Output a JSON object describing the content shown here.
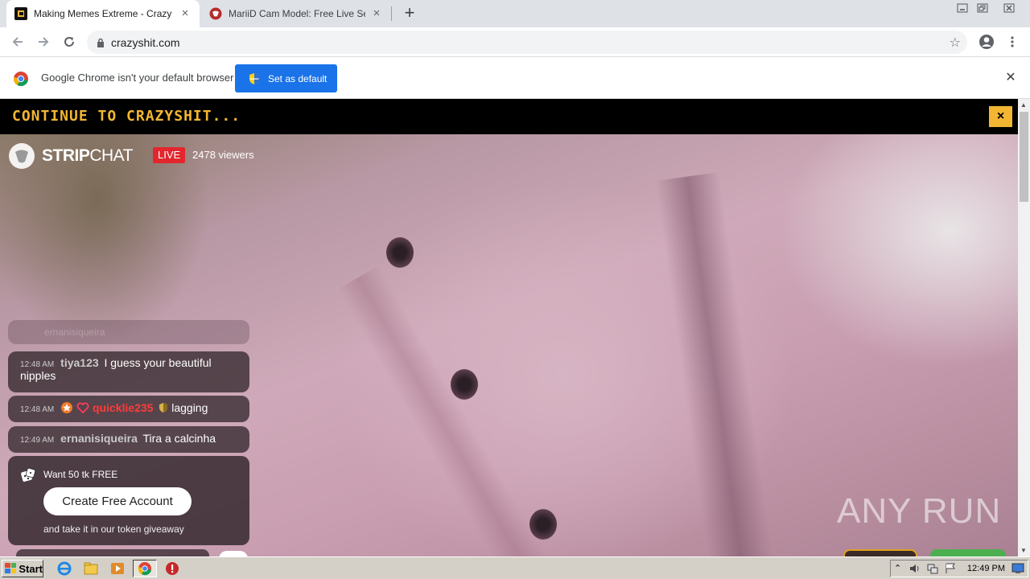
{
  "browser": {
    "tabs": [
      {
        "title": "Making Memes Extreme - Crazy Shit",
        "active": true
      },
      {
        "title": "MariiD Cam Model: Free Live Sex Sh",
        "active": false
      }
    ],
    "url": "crazyshit.com",
    "infobar": {
      "message": "Google Chrome isn't your default browser",
      "button": "Set as default"
    }
  },
  "page": {
    "banner_text": "CONTINUE TO CRAZYSHIT...",
    "banner_close": "×",
    "logo_bold": "STRIP",
    "logo_light": "CHAT",
    "live_badge": "LIVE",
    "viewers": "2478 viewers",
    "faded_message": "ernanisiqueira",
    "chat": [
      {
        "time": "12:48 AM",
        "user": "tiya123",
        "text": "I guess your beautiful nipples"
      },
      {
        "time": "12:48 AM",
        "user": "quicklie235",
        "text": "lagging"
      },
      {
        "time": "12:49 AM",
        "user": "ernanisiqueira",
        "text": "Tira a calcinha"
      }
    ],
    "promo": {
      "headline": "Want 50 tk FREE",
      "button": "Create Free Account",
      "subtext": "and take it in our token giveaway"
    },
    "watermark": "ANY RUN"
  },
  "taskbar": {
    "start": "Start",
    "clock": "12:49 PM"
  },
  "colors": {
    "banner_accent": "#f2b632",
    "live_red": "#e3262e",
    "chrome_blue": "#1a73e8"
  }
}
